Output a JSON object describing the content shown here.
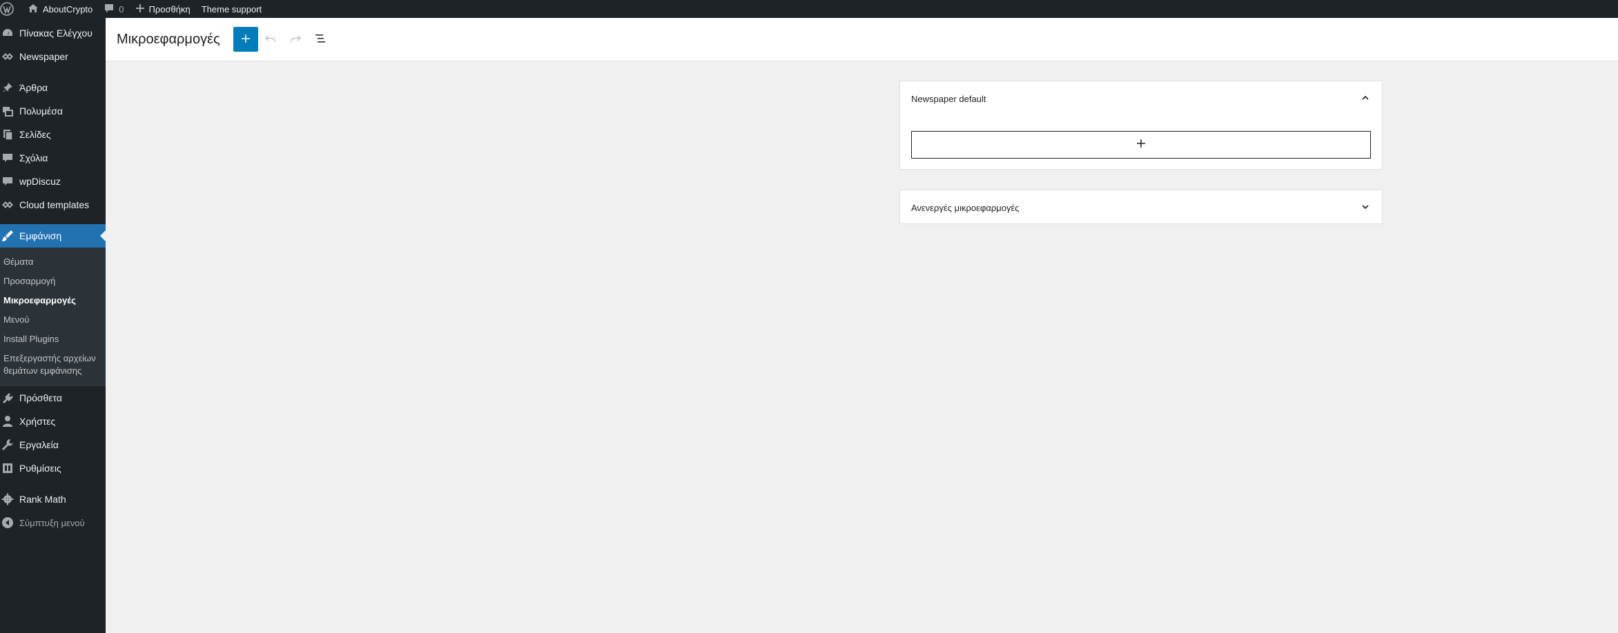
{
  "adminbar": {
    "site_name": "AboutCrypto",
    "comment_count": "0",
    "new_label": "Προσθήκη",
    "theme_support": "Theme support"
  },
  "sidebar": {
    "items": [
      {
        "label": "Πίνακας Ελέγχου",
        "icon": "dashboard-icon"
      },
      {
        "label": "Newspaper",
        "icon": "newspaper-icon"
      },
      {
        "label": "Άρθρα",
        "icon": "pin-icon"
      },
      {
        "label": "Πολυμέσα",
        "icon": "media-icon"
      },
      {
        "label": "Σελίδες",
        "icon": "pages-icon"
      },
      {
        "label": "Σχόλια",
        "icon": "comment-icon"
      },
      {
        "label": "wpDiscuz",
        "icon": "comment-icon"
      },
      {
        "label": "Cloud templates",
        "icon": "cloud-templates-icon"
      },
      {
        "label": "Εμφάνιση",
        "icon": "brush-icon"
      },
      {
        "label": "Πρόσθετα",
        "icon": "plugin-icon"
      },
      {
        "label": "Χρήστες",
        "icon": "user-icon"
      },
      {
        "label": "Εργαλεία",
        "icon": "wrench-icon"
      },
      {
        "label": "Ρυθμίσεις",
        "icon": "settings-icon"
      },
      {
        "label": "Rank Math",
        "icon": "gear-icon"
      },
      {
        "label": "Σύμπτυξη μενού",
        "icon": "collapse-icon"
      }
    ],
    "submenu": [
      "Θέματα",
      "Προσαρμογή",
      "Μικροεφαρμογές",
      "Μενού",
      "Install Plugins",
      "Επεξεργαστής αρχείων θεμάτων εμφάνισης"
    ]
  },
  "header": {
    "title": "Μικροεφαρμογές"
  },
  "panels": {
    "default_title": "Newspaper default",
    "inactive_title": "Ανενεργές μικροεφαρμογές"
  },
  "colors": {
    "accent": "#2271b1",
    "admin_dark": "#1d2327",
    "button_blue": "#007cba"
  }
}
